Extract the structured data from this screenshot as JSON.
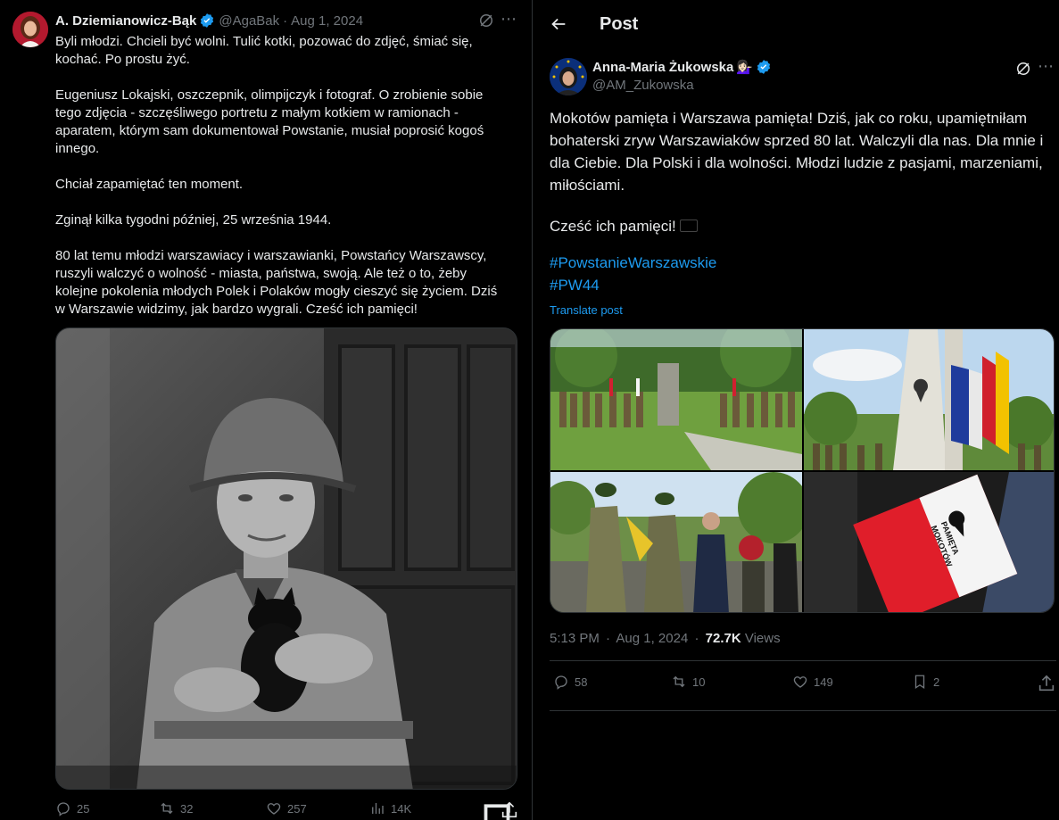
{
  "left_tweet": {
    "author_name": "A. Dziemianowicz-Bąk",
    "handle": "@AgaBak",
    "separator": "·",
    "date": "Aug 1, 2024",
    "paragraphs": [
      "Byli młodzi. Chcieli być wolni. Tulić kotki, pozować do zdjęć, śmiać się, kochać. Po prostu żyć.",
      "Eugeniusz Lokajski, oszczepnik, olimpijczyk i fotograf. O zrobienie sobie tego zdjęcia - szczęśliwego portretu z małym kotkiem w ramionach - aparatem, którym sam dokumentował Powstanie, musiał poprosić kogoś innego.",
      "Chciał zapamiętać ten moment.",
      "Zginął kilka tygodni później, 25 września 1944.",
      "80 lat temu młodzi warszawiacy i warszawianki, Powstańcy Warszawscy, ruszyli walczyć o wolność - miasta, państwa, swoją. Ale też o to, żeby kolejne pokolenia młodych Polek i Polaków mogły cieszyć się życiem. Dziś w Warszawie widzimy, jak bardzo wygrali. Cześć ich pamięci!"
    ],
    "actions": {
      "replies": "25",
      "reposts": "32",
      "likes": "257",
      "views": "14K"
    }
  },
  "right_post": {
    "header_title": "Post",
    "author_name": "Anna-Maria Żukowska",
    "author_emoji": "💁🏻‍♀️",
    "handle": "@AM_Zukowska",
    "paragraph1": "Mokotów pamięta i Warszawa pamięta! Dziś, jak co roku, upamiętniłam bohaterski zryw Warszawiaków sprzed 80 lat. Walczyli dla nas. Dla mnie i dla Ciebie. Dla Polski i dla wolności. Młodzi ludzie z pasjami, marzeniami, miłościami.",
    "paragraph2": "Cześć ich pamięci!",
    "hashtags": [
      "#PowstanieWarszawskie",
      "#PW44"
    ],
    "translate_label": "Translate post",
    "meta": {
      "time": "5:13 PM",
      "separator": "·",
      "date": "Aug 1, 2024",
      "views_count": "72.7K",
      "views_label": "Views"
    },
    "armband_text": [
      "MOKOTÓW",
      "PAMIĘTA"
    ],
    "actions": {
      "replies": "58",
      "reposts": "10",
      "likes": "149",
      "bookmarks": "2"
    }
  },
  "colors": {
    "background": "#000000",
    "text": "#e7e9ea",
    "muted": "#71767b",
    "accent": "#1d9bf0",
    "border": "#2f3336"
  },
  "icons": [
    "verified-badge-icon",
    "grok-icon",
    "more-icon",
    "reply-icon",
    "repost-icon",
    "like-icon",
    "views-icon",
    "bookmark-icon",
    "share-icon",
    "back-arrow-icon"
  ]
}
